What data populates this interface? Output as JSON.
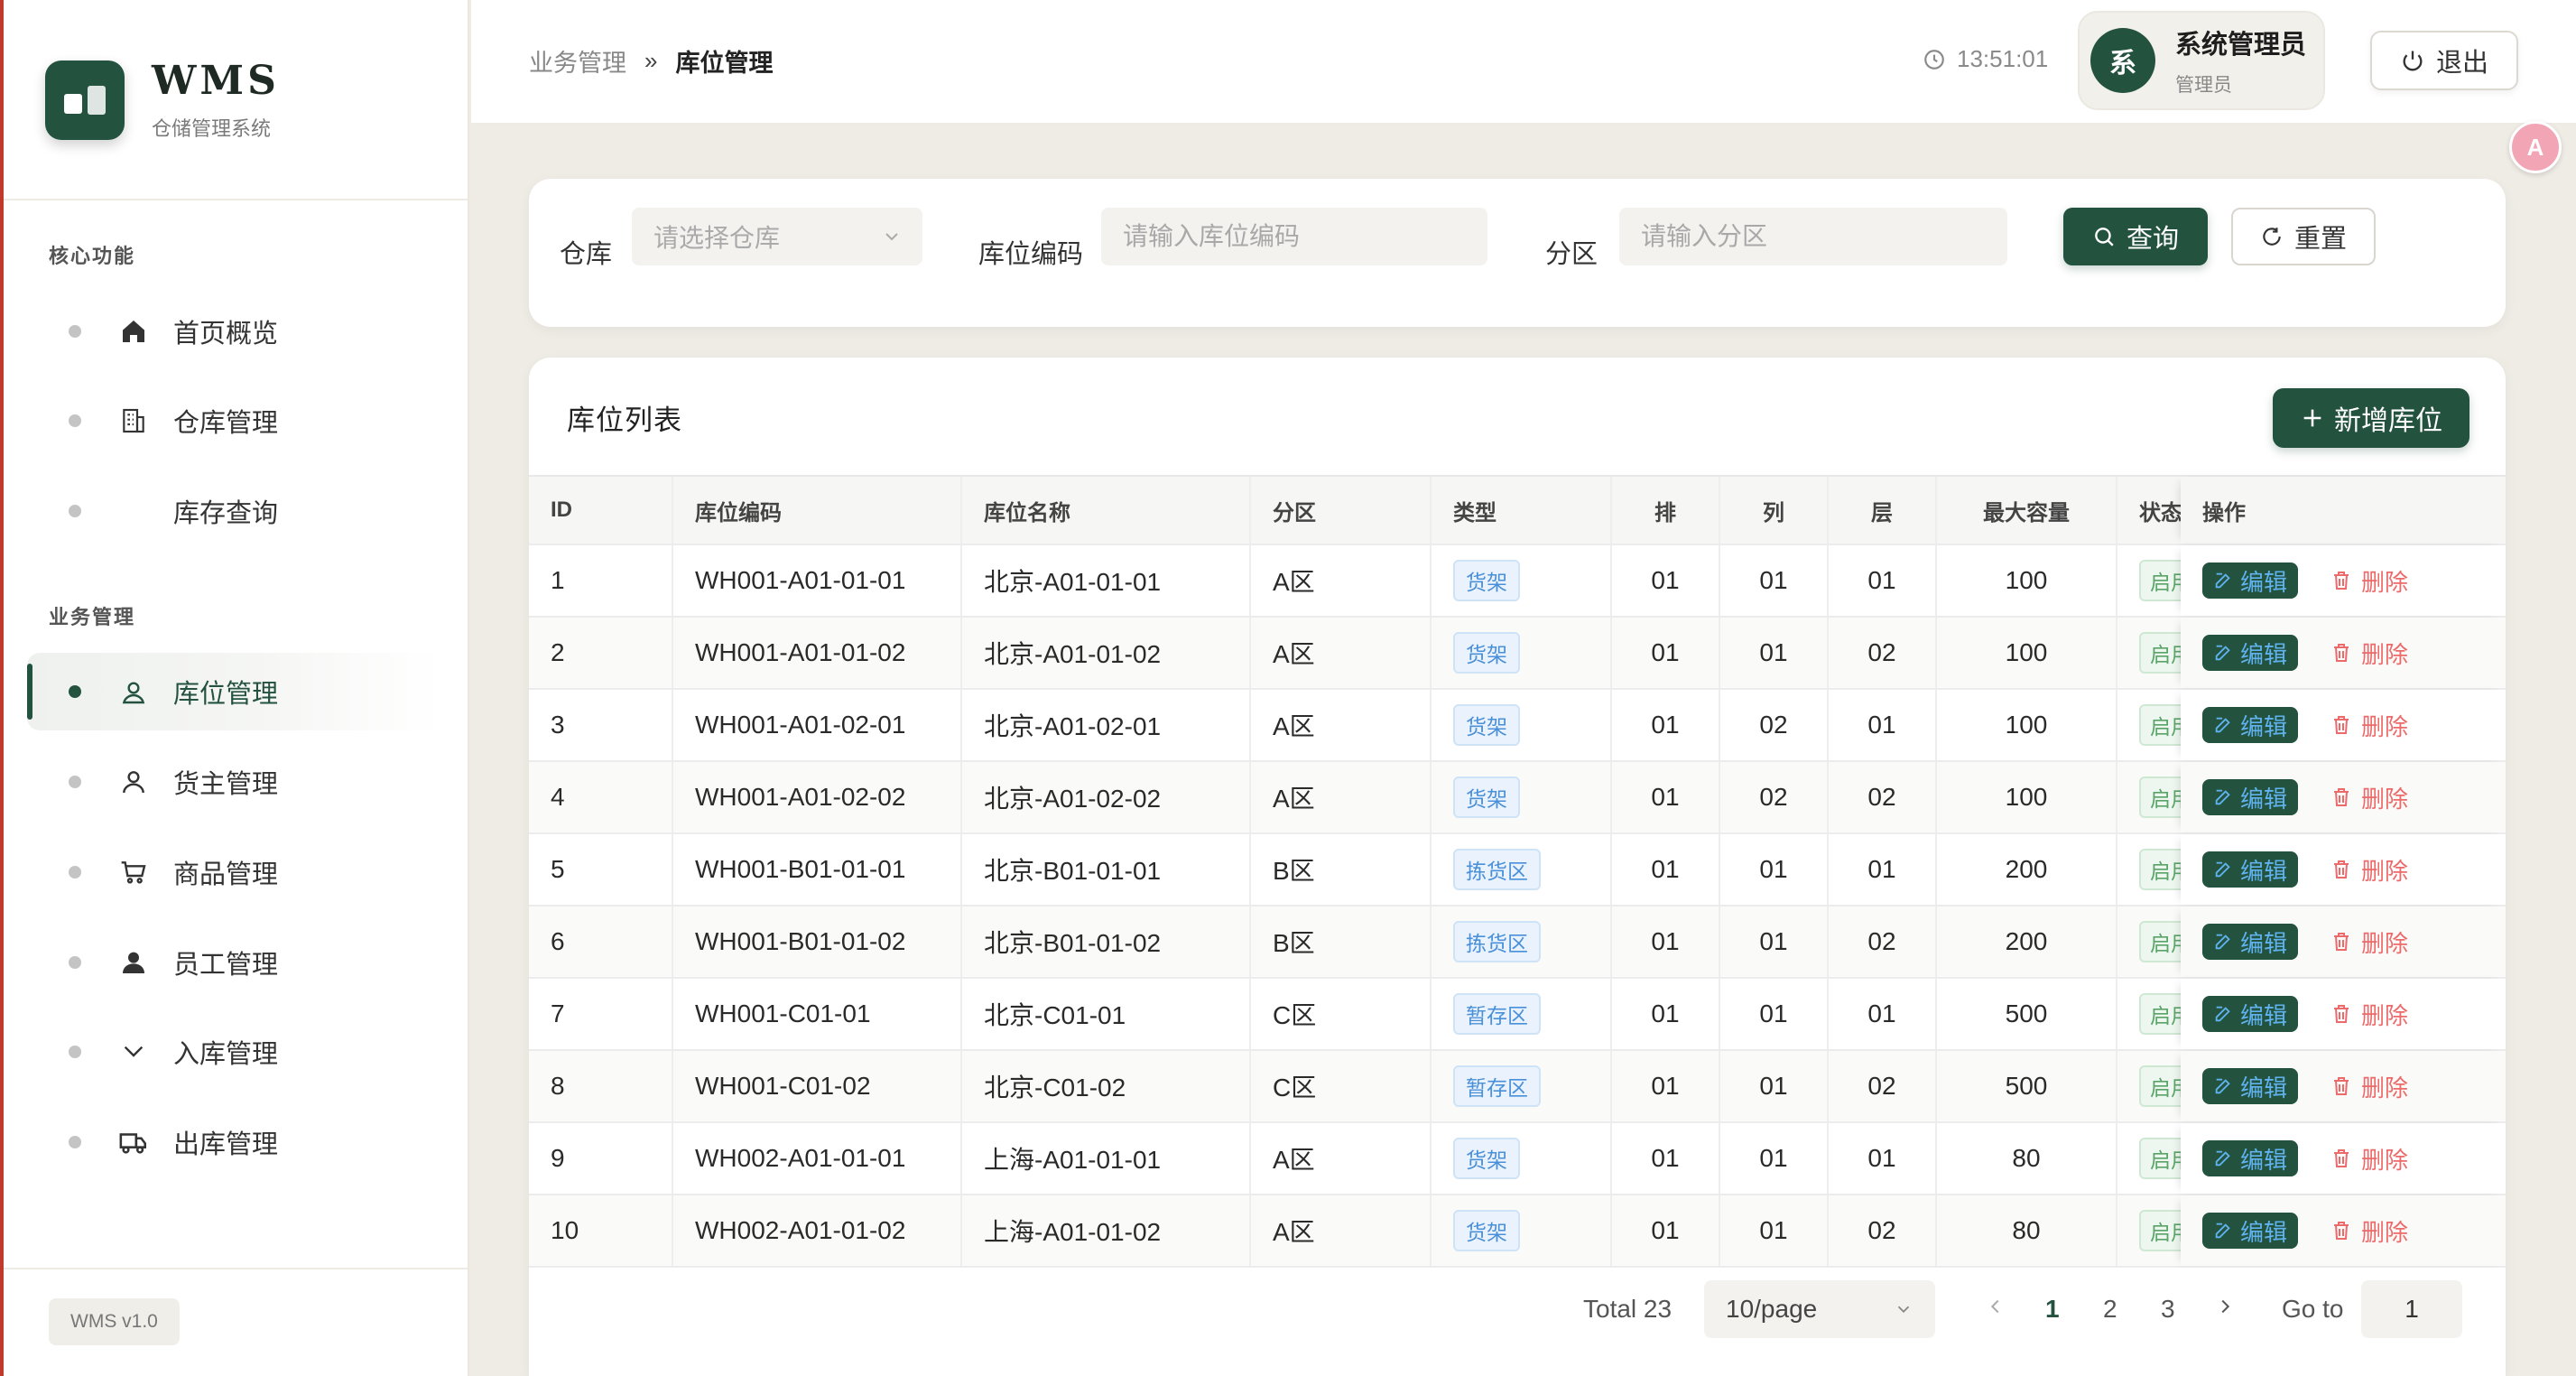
{
  "app": {
    "title": "WMS",
    "subtitle": "仓储管理系统",
    "version": "WMS v1.0",
    "accent": "#23523f"
  },
  "sidebar": {
    "groups": [
      {
        "title": "核心功能",
        "items": [
          {
            "label": "首页概览",
            "icon": "home-icon"
          },
          {
            "label": "仓库管理",
            "icon": "building-icon"
          },
          {
            "label": "库存查询",
            "icon": ""
          }
        ]
      },
      {
        "title": "业务管理",
        "items": [
          {
            "label": "库位管理",
            "icon": "location-user-icon",
            "active": true
          },
          {
            "label": "货主管理",
            "icon": "user-outline-icon"
          },
          {
            "label": "商品管理",
            "icon": "cart-icon"
          },
          {
            "label": "员工管理",
            "icon": "user-filled-icon"
          },
          {
            "label": "入库管理",
            "icon": "chevron-down-icon"
          },
          {
            "label": "出库管理",
            "icon": "truck-icon"
          }
        ]
      }
    ]
  },
  "header": {
    "breadcrumb": [
      "业务管理",
      "库位管理"
    ],
    "breadcrumb_sep": "»",
    "time": "13:51:01",
    "user_initial": "系",
    "user_name": "系统管理员",
    "user_role": "管理员",
    "logout_label": "退出"
  },
  "filters": {
    "warehouse_label": "仓库",
    "warehouse_placeholder": "请选择仓库",
    "code_label": "库位编码",
    "code_placeholder": "请输入库位编码",
    "zone_label": "分区",
    "zone_placeholder": "请输入分区",
    "search_label": "查询",
    "reset_label": "重置"
  },
  "table": {
    "title": "库位列表",
    "add_label": "新增库位",
    "columns": [
      "ID",
      "库位编码",
      "库位名称",
      "分区",
      "类型",
      "排",
      "列",
      "层",
      "最大容量",
      "状态",
      "操作"
    ],
    "rows": [
      {
        "id": "1",
        "code": "WH001-A01-01-01",
        "name": "北京-A01-01-01",
        "zone": "A区",
        "type": "货架",
        "row": "01",
        "col": "01",
        "layer": "01",
        "capacity": "100",
        "status": "启用"
      },
      {
        "id": "2",
        "code": "WH001-A01-01-02",
        "name": "北京-A01-01-02",
        "zone": "A区",
        "type": "货架",
        "row": "01",
        "col": "01",
        "layer": "02",
        "capacity": "100",
        "status": "启用"
      },
      {
        "id": "3",
        "code": "WH001-A01-02-01",
        "name": "北京-A01-02-01",
        "zone": "A区",
        "type": "货架",
        "row": "01",
        "col": "02",
        "layer": "01",
        "capacity": "100",
        "status": "启用"
      },
      {
        "id": "4",
        "code": "WH001-A01-02-02",
        "name": "北京-A01-02-02",
        "zone": "A区",
        "type": "货架",
        "row": "01",
        "col": "02",
        "layer": "02",
        "capacity": "100",
        "status": "启用"
      },
      {
        "id": "5",
        "code": "WH001-B01-01-01",
        "name": "北京-B01-01-01",
        "zone": "B区",
        "type": "拣货区",
        "row": "01",
        "col": "01",
        "layer": "01",
        "capacity": "200",
        "status": "启用"
      },
      {
        "id": "6",
        "code": "WH001-B01-01-02",
        "name": "北京-B01-01-02",
        "zone": "B区",
        "type": "拣货区",
        "row": "01",
        "col": "01",
        "layer": "02",
        "capacity": "200",
        "status": "启用"
      },
      {
        "id": "7",
        "code": "WH001-C01-01",
        "name": "北京-C01-01",
        "zone": "C区",
        "type": "暂存区",
        "row": "01",
        "col": "01",
        "layer": "01",
        "capacity": "500",
        "status": "启用"
      },
      {
        "id": "8",
        "code": "WH001-C01-02",
        "name": "北京-C01-02",
        "zone": "C区",
        "type": "暂存区",
        "row": "01",
        "col": "01",
        "layer": "02",
        "capacity": "500",
        "status": "启用"
      },
      {
        "id": "9",
        "code": "WH002-A01-01-01",
        "name": "上海-A01-01-01",
        "zone": "A区",
        "type": "货架",
        "row": "01",
        "col": "01",
        "layer": "01",
        "capacity": "80",
        "status": "启用"
      },
      {
        "id": "10",
        "code": "WH002-A01-01-02",
        "name": "上海-A01-01-02",
        "zone": "A区",
        "type": "货架",
        "row": "01",
        "col": "01",
        "layer": "02",
        "capacity": "80",
        "status": "启用"
      }
    ],
    "edit_label": "编辑",
    "delete_label": "删除"
  },
  "pagination": {
    "total_text": "Total 23",
    "page_size": "10/page",
    "pages": [
      "1",
      "2",
      "3"
    ],
    "current_page": "1",
    "goto_label": "Go to",
    "goto_value": "1"
  }
}
